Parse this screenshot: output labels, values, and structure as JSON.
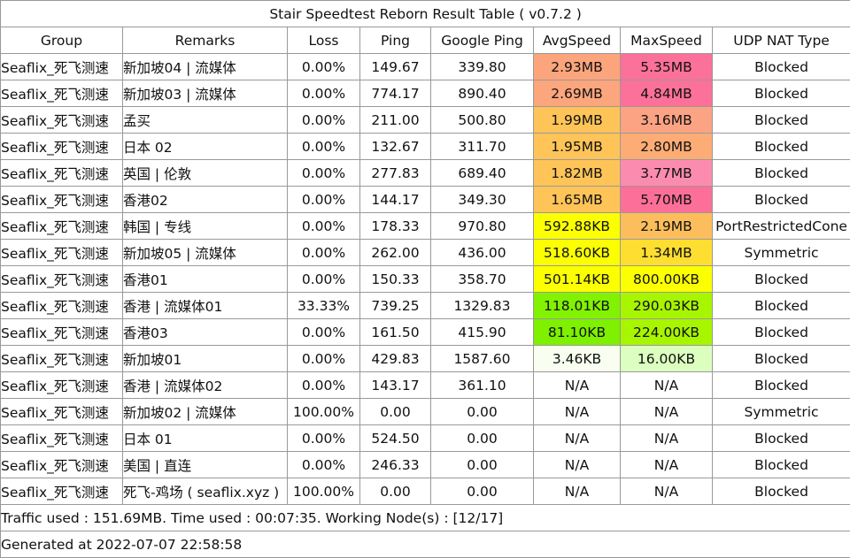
{
  "title": "Stair Speedtest Reborn Result Table ( v0.7.2 )",
  "columns": [
    "Group",
    "Remarks",
    "Loss",
    "Ping",
    "Google Ping",
    "AvgSpeed",
    "MaxSpeed",
    "UDP NAT Type"
  ],
  "rows": [
    {
      "group": "Seaflix_死飞测速",
      "remarks": "新加坡04 | 流媒体",
      "loss": "0.00%",
      "ping": "149.67",
      "google_ping": "339.80",
      "avg": "2.93MB",
      "max": "5.35MB",
      "nat": "Blocked",
      "avg_color": "#fca57c",
      "max_color": "#fc7199"
    },
    {
      "group": "Seaflix_死飞测速",
      "remarks": "新加坡03 | 流媒体",
      "loss": "0.00%",
      "ping": "774.17",
      "google_ping": "890.40",
      "avg": "2.69MB",
      "max": "4.84MB",
      "nat": "Blocked",
      "avg_color": "#fca67d",
      "max_color": "#fc7199"
    },
    {
      "group": "Seaflix_死飞测速",
      "remarks": "孟买",
      "loss": "0.00%",
      "ping": "211.00",
      "google_ping": "500.80",
      "avg": "1.99MB",
      "max": "3.16MB",
      "nat": "Blocked",
      "avg_color": "#fec458",
      "max_color": "#fca384"
    },
    {
      "group": "Seaflix_死飞测速",
      "remarks": "日本 02",
      "loss": "0.00%",
      "ping": "132.67",
      "google_ping": "311.70",
      "avg": "1.95MB",
      "max": "2.80MB",
      "nat": "Blocked",
      "avg_color": "#fec458",
      "max_color": "#fcac74"
    },
    {
      "group": "Seaflix_死飞测速",
      "remarks": "英国 | 伦敦",
      "loss": "0.00%",
      "ping": "277.83",
      "google_ping": "689.40",
      "avg": "1.82MB",
      "max": "3.77MB",
      "nat": "Blocked",
      "avg_color": "#fec458",
      "max_color": "#fb8cb0"
    },
    {
      "group": "Seaflix_死飞测速",
      "remarks": "香港02",
      "loss": "0.00%",
      "ping": "144.17",
      "google_ping": "349.30",
      "avg": "1.65MB",
      "max": "5.70MB",
      "nat": "Blocked",
      "avg_color": "#fec458",
      "max_color": "#fc6f98"
    },
    {
      "group": "Seaflix_死飞测速",
      "remarks": "韩国 | 专线",
      "loss": "0.00%",
      "ping": "178.33",
      "google_ping": "970.80",
      "avg": "592.88KB",
      "max": "2.19MB",
      "nat": "PortRestrictedCone",
      "avg_color": "#fbff00",
      "max_color": "#fcbe5c"
    },
    {
      "group": "Seaflix_死飞测速",
      "remarks": "新加坡05 | 流媒体",
      "loss": "0.00%",
      "ping": "262.00",
      "google_ping": "436.00",
      "avg": "518.60KB",
      "max": "1.34MB",
      "nat": "Symmetric",
      "avg_color": "#fbff00",
      "max_color": "#fede30"
    },
    {
      "group": "Seaflix_死飞测速",
      "remarks": "香港01",
      "loss": "0.00%",
      "ping": "150.33",
      "google_ping": "358.70",
      "avg": "501.14KB",
      "max": "800.00KB",
      "nat": "Blocked",
      "avg_color": "#fbff00",
      "max_color": "#fbff00"
    },
    {
      "group": "Seaflix_死飞测速",
      "remarks": "香港 | 流媒体01",
      "loss": "33.33%",
      "ping": "739.25",
      "google_ping": "1329.83",
      "avg": "118.01KB",
      "max": "290.03KB",
      "nat": "Blocked",
      "avg_color": "#82f200",
      "max_color": "#a8f500"
    },
    {
      "group": "Seaflix_死飞测速",
      "remarks": "香港03",
      "loss": "0.00%",
      "ping": "161.50",
      "google_ping": "415.90",
      "avg": "81.10KB",
      "max": "224.00KB",
      "nat": "Blocked",
      "avg_color": "#7ef000",
      "max_color": "#a8f500"
    },
    {
      "group": "Seaflix_死飞测速",
      "remarks": "新加坡01",
      "loss": "0.00%",
      "ping": "429.83",
      "google_ping": "1587.60",
      "avg": "3.46KB",
      "max": "16.00KB",
      "nat": "Blocked",
      "avg_color": "#f8fff0",
      "max_color": "#dcffc0"
    },
    {
      "group": "Seaflix_死飞测速",
      "remarks": "香港 | 流媒体02",
      "loss": "0.00%",
      "ping": "143.17",
      "google_ping": "361.10",
      "avg": "N/A",
      "max": "N/A",
      "nat": "Blocked",
      "avg_color": "#ffffff",
      "max_color": "#ffffff"
    },
    {
      "group": "Seaflix_死飞测速",
      "remarks": "新加坡02 | 流媒体",
      "loss": "100.00%",
      "ping": "0.00",
      "google_ping": "0.00",
      "avg": "N/A",
      "max": "N/A",
      "nat": "Symmetric",
      "avg_color": "#ffffff",
      "max_color": "#ffffff"
    },
    {
      "group": "Seaflix_死飞测速",
      "remarks": "日本 01",
      "loss": "0.00%",
      "ping": "524.50",
      "google_ping": "0.00",
      "avg": "N/A",
      "max": "N/A",
      "nat": "Blocked",
      "avg_color": "#ffffff",
      "max_color": "#ffffff"
    },
    {
      "group": "Seaflix_死飞测速",
      "remarks": "美国 | 直连",
      "loss": "0.00%",
      "ping": "246.33",
      "google_ping": "0.00",
      "avg": "N/A",
      "max": "N/A",
      "nat": "Blocked",
      "avg_color": "#ffffff",
      "max_color": "#ffffff"
    },
    {
      "group": "Seaflix_死飞测速",
      "remarks": "死飞-鸡场 ( seaflix.xyz )",
      "loss": "100.00%",
      "ping": "0.00",
      "google_ping": "0.00",
      "avg": "N/A",
      "max": "N/A",
      "nat": "Blocked",
      "avg_color": "#ffffff",
      "max_color": "#ffffff"
    }
  ],
  "traffic_line": "Traffic used : 151.69MB. Time used : 00:07:35. Working Node(s) : [12/17]",
  "generated_line": "Generated at 2022-07-07 22:58:58"
}
